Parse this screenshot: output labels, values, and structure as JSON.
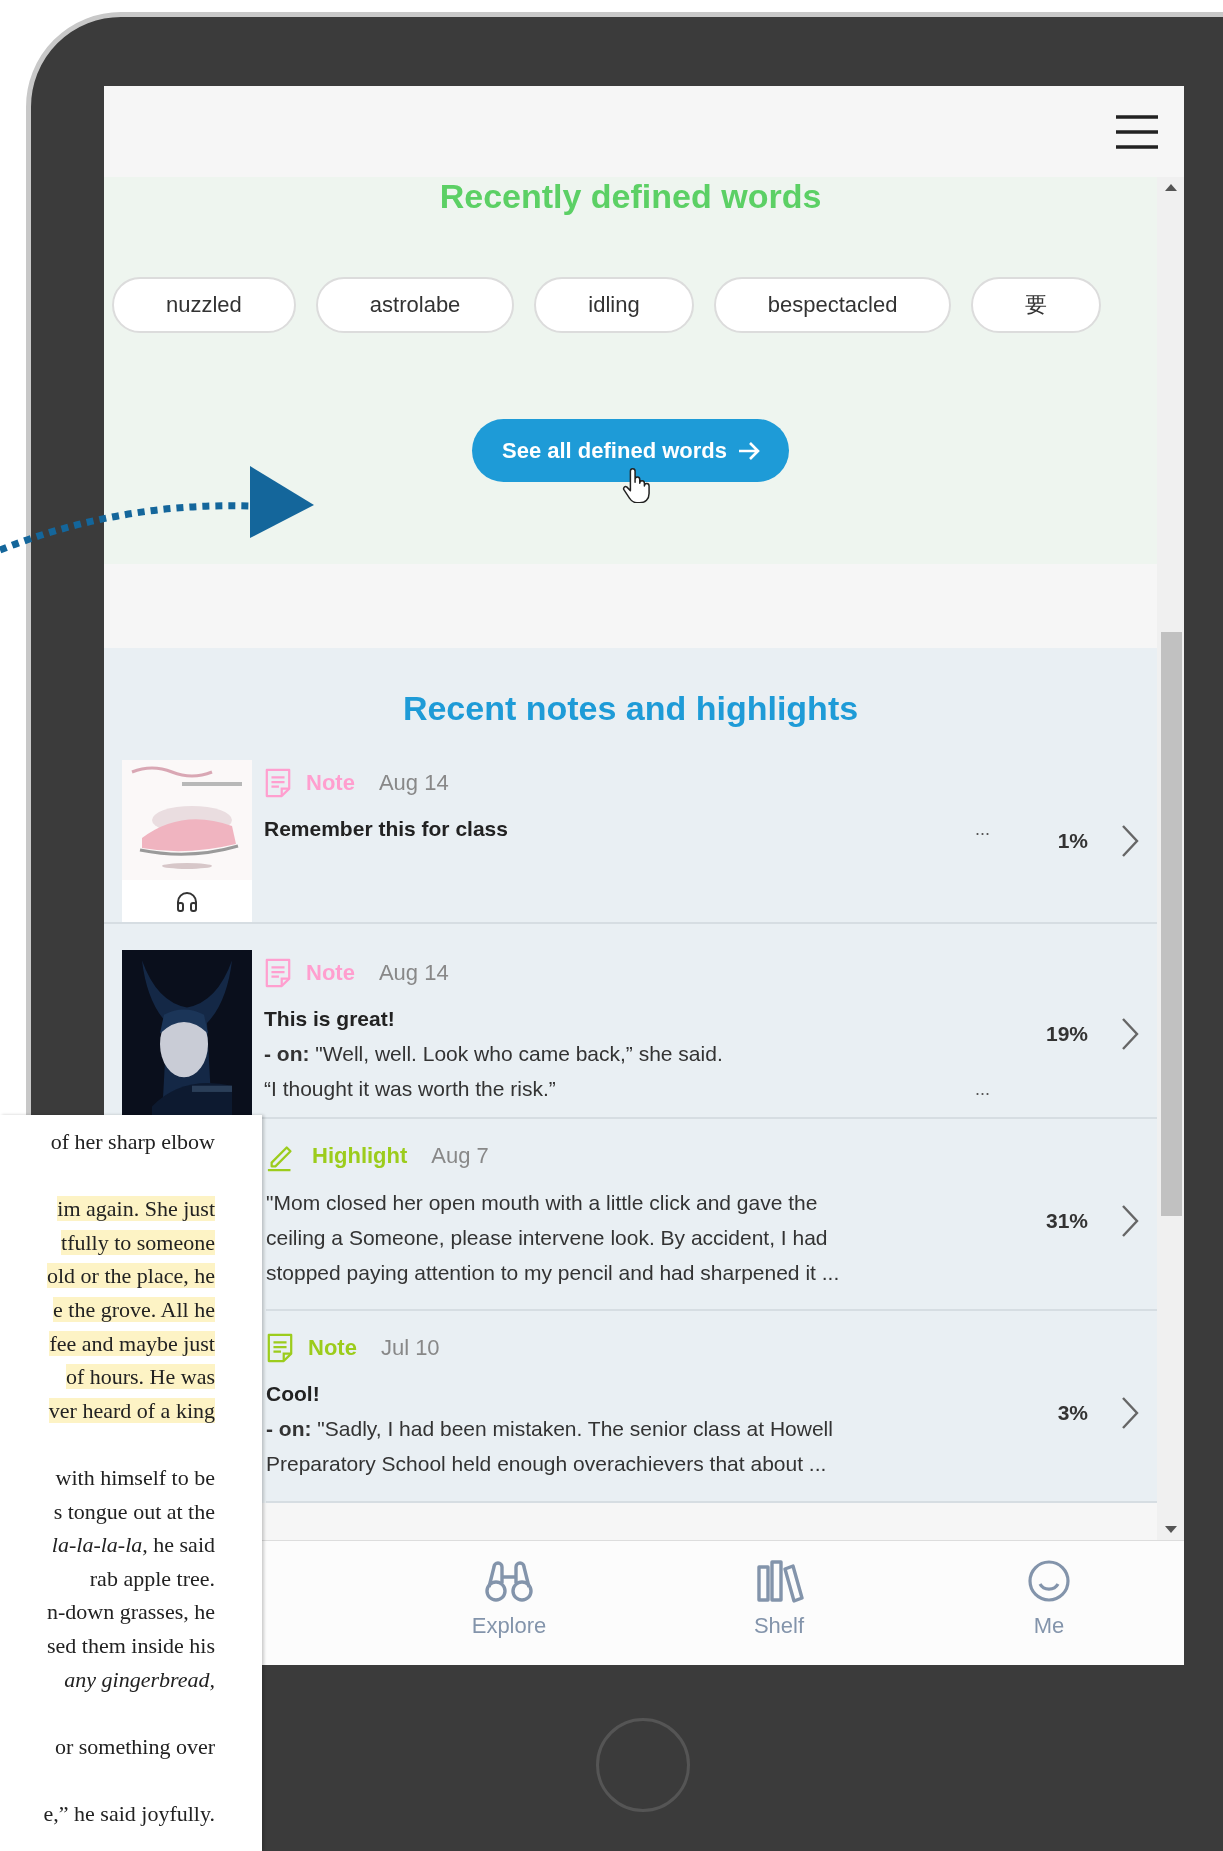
{
  "defined_words": {
    "title": "Recently defined words",
    "words": [
      "nuzzled",
      "astrolabe",
      "idling",
      "bespectacled",
      "要"
    ],
    "button": "See all defined words"
  },
  "notes": {
    "title": "Recent notes and highlights",
    "items": [
      {
        "kind": "note",
        "label": "Note",
        "date": "Aug 14",
        "color": "#ff9fcf",
        "audio": true,
        "title": "Remember this for class",
        "ellipsis": "...",
        "percent": "1%"
      },
      {
        "kind": "note",
        "label": "Note",
        "date": "Aug 14",
        "color": "#ff9fcf",
        "audio": false,
        "title": "This is great!",
        "quote": "**- on:** \"Well, well. Look who came back,” she said.\n“I thought it was worth the risk.”",
        "ellipsis": "...",
        "percent": "19%"
      },
      {
        "kind": "highlight",
        "label": "Highlight",
        "date": "Aug 7",
        "color": "#9ccc1c",
        "quote": "\"Mom closed her open mouth with a little click and gave the\nceiling a Someone, please intervene look. By accident, I had\nstopped paying attention to my pencil and had sharpened it ...",
        "percent": "31%"
      },
      {
        "kind": "note",
        "label": "Note",
        "date": "Jul 10",
        "color": "#9ccc1c",
        "title": "Cool!",
        "quote": "**- on:** \"Sadly, I had been mistaken. The senior class at Howell\nPreparatory School held enough overachievers that about ...",
        "percent": "3%"
      }
    ]
  },
  "tab_bar": {
    "tabs": [
      {
        "kind": "binoculars",
        "label": "Explore",
        "selected": false
      },
      {
        "kind": "books",
        "label": "Shelf",
        "selected": false
      },
      {
        "kind": "smiley",
        "label": "Me",
        "selected": false
      }
    ]
  },
  "book_page": {
    "paragraphs": [
      {
        "text": "of her sharp elbow",
        "highlighted": false
      },
      {
        "text": "im again. She just\ntfully to someone\nold or the place, he\ne the grove. All he\nfee and maybe just\nof hours. He was\nver heard of a king",
        "highlighted": true
      },
      {
        "text": "with himself to be\ns tongue out at the\n*la-la-la-la,* he said\nrab apple tree.\nn-down grasses, he\nsed them inside his\n*any gingerbread,*",
        "highlighted": false
      },
      {
        "text": "or something over",
        "highlighted": false
      },
      {
        "text": "e,” he said joyfully.",
        "highlighted": false
      }
    ]
  }
}
